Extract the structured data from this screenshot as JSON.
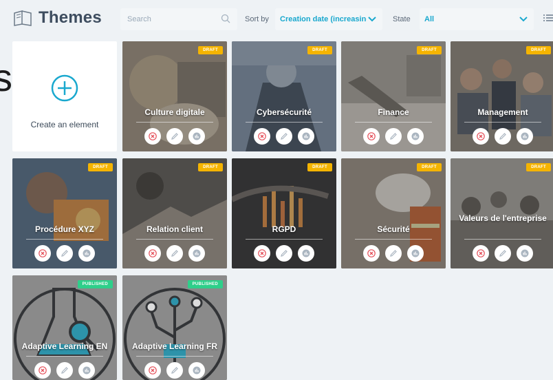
{
  "header": {
    "title": "Themes",
    "search_placeholder": "Search",
    "sort_label": "Sort by",
    "sort_value": "Creation date (increasing",
    "state_label": "State",
    "state_value": "All"
  },
  "side_fragment": "s",
  "create": {
    "label": "Create an element"
  },
  "cards": [
    {
      "title": "Culture digitale",
      "status": "DRAFT"
    },
    {
      "title": "Cybersécurité",
      "status": "DRAFT"
    },
    {
      "title": "Finance",
      "status": "DRAFT"
    },
    {
      "title": "Management",
      "status": "DRAFT"
    },
    {
      "title": "Procédure XYZ",
      "status": "DRAFT"
    },
    {
      "title": "Relation client",
      "status": "DRAFT"
    },
    {
      "title": "RGPD",
      "status": "DRAFT"
    },
    {
      "title": "Sécurité",
      "status": "DRAFT"
    },
    {
      "title": "Valeurs de l'entreprise",
      "status": "DRAFT"
    },
    {
      "title": "Adaptive Learning EN",
      "status": "PUBLISHED"
    },
    {
      "title": "Adaptive Learning FR",
      "status": "PUBLISHED"
    }
  ],
  "colors": {
    "accent": "#19a8ce",
    "draft": "#f5b400",
    "published": "#2ecf8a",
    "delete": "#e5505a"
  },
  "icons": [
    "book-icon",
    "search-icon",
    "chevron-down-icon",
    "list-view-icon",
    "plus-circle-icon",
    "delete-icon",
    "edit-icon",
    "stats-icon"
  ]
}
